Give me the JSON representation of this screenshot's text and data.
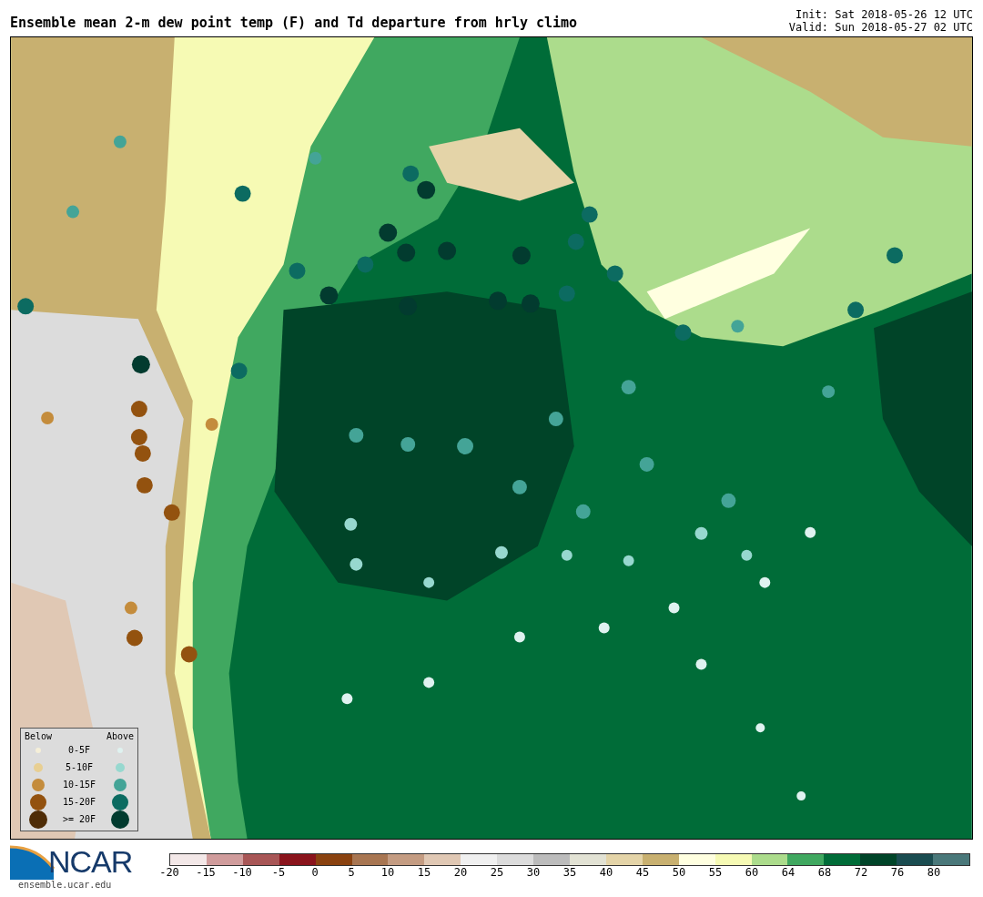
{
  "title": "Ensemble mean 2-m dew point temp (F) and Td departure from hrly climo",
  "run_info": [
    "Init: Sat 2018-05-26 12 UTC",
    "Valid: Sun 2018-05-27 02 UTC"
  ],
  "legend": {
    "below_heading": "Below",
    "above_heading": "Above",
    "rows": [
      {
        "label": "0-5F",
        "below": {
          "color": "#f5efd8"
        },
        "above": {
          "color": "#dff2f0"
        }
      },
      {
        "label": "5-10F",
        "below": {
          "color": "#e8cf92"
        },
        "above": {
          "color": "#97d8cf"
        }
      },
      {
        "label": "10-15F",
        "below": {
          "color": "#c48c3c"
        },
        "above": {
          "color": "#44a497"
        }
      },
      {
        "label": "15-20F",
        "below": {
          "color": "#93520f"
        },
        "above": {
          "color": "#0c6b61"
        }
      },
      {
        "label": ">= 20F",
        "below": {
          "color": "#4e2c06"
        },
        "above": {
          "color": "#023b2f"
        }
      }
    ]
  },
  "logo": {
    "name": "NCAR",
    "url": "ensemble.ucar.edu"
  },
  "colorbar": {
    "swatches": [
      {
        "color": "#f3e8e8"
      },
      {
        "color": "#d09c9c"
      },
      {
        "color": "#a85656"
      },
      {
        "color": "#8a141c"
      },
      {
        "color": "#8a4210"
      },
      {
        "color": "#a87652"
      },
      {
        "color": "#c49c82"
      },
      {
        "color": "#e0c8b4"
      },
      {
        "color": "#f0f0f0"
      },
      {
        "color": "#dcdcdc"
      },
      {
        "color": "#bcbcbc"
      },
      {
        "color": "#e2e2d4"
      },
      {
        "color": "#e4d4a8"
      },
      {
        "color": "#c8b070"
      },
      {
        "color": "#ffffe0"
      },
      {
        "color": "#f6fab4"
      },
      {
        "color": "#acdc8c"
      },
      {
        "color": "#40a860"
      },
      {
        "color": "#006c38"
      },
      {
        "color": "#004428"
      },
      {
        "color": "#1a4c50"
      },
      {
        "color": "#4a787a"
      }
    ],
    "ticks": [
      "-20",
      "-15",
      "-10",
      "-5",
      "0",
      "5",
      "10",
      "15",
      "20",
      "25",
      "30",
      "35",
      "40",
      "45",
      "50",
      "55",
      "60",
      "64",
      "68",
      "72",
      "76",
      "80"
    ]
  }
}
